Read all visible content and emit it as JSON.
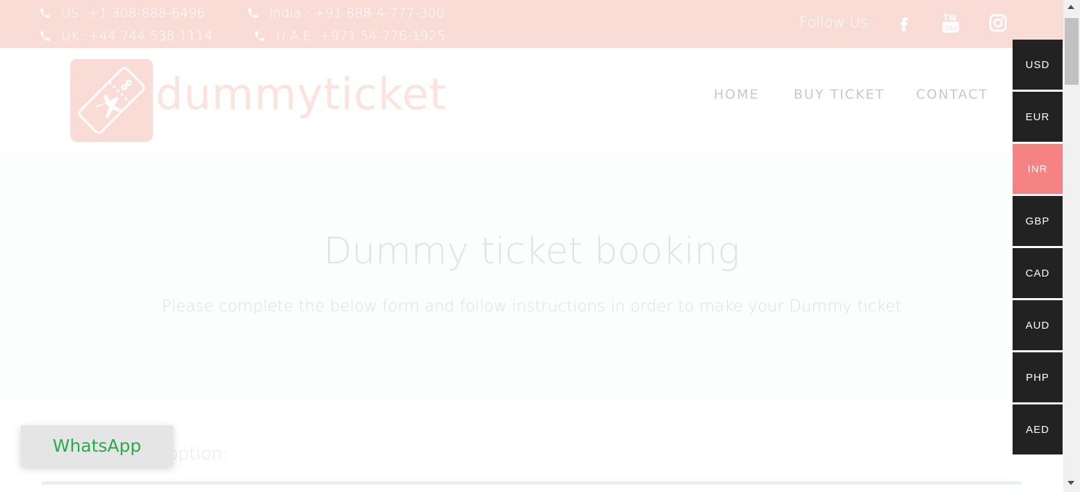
{
  "topbar": {
    "phones": [
      {
        "label": "US: +1 308-888-6496"
      },
      {
        "label": "India : +91 888-4-777-300"
      },
      {
        "label": "UK :+44 744 538 1114"
      },
      {
        "label": "U.A.E :+971 54-776-1925"
      }
    ],
    "follow_label": "Follow Us:",
    "social_icons": [
      "facebook-icon",
      "youtube-icon",
      "instagram-icon"
    ]
  },
  "header": {
    "logo_text": "dummyticket",
    "nav": [
      "HOME",
      "BUY TICKET",
      "CONTACT"
    ]
  },
  "hero": {
    "title": "Dummy ticket booking",
    "subtitle": "Please complete the below form and follow instructions in order to make your Dummy ticket"
  },
  "form": {
    "option_label": "Select correct option:"
  },
  "whatsapp": {
    "label": "WhatsApp"
  },
  "currency": {
    "options": [
      "USD",
      "EUR",
      "INR",
      "GBP",
      "CAD",
      "AUD",
      "PHP",
      "AED"
    ],
    "active": "INR"
  },
  "colors": {
    "topbar_bg": "#f9dcd6",
    "currency_bg": "#222222",
    "currency_active": "#f58383",
    "whatsapp_text": "#2aa94b"
  }
}
